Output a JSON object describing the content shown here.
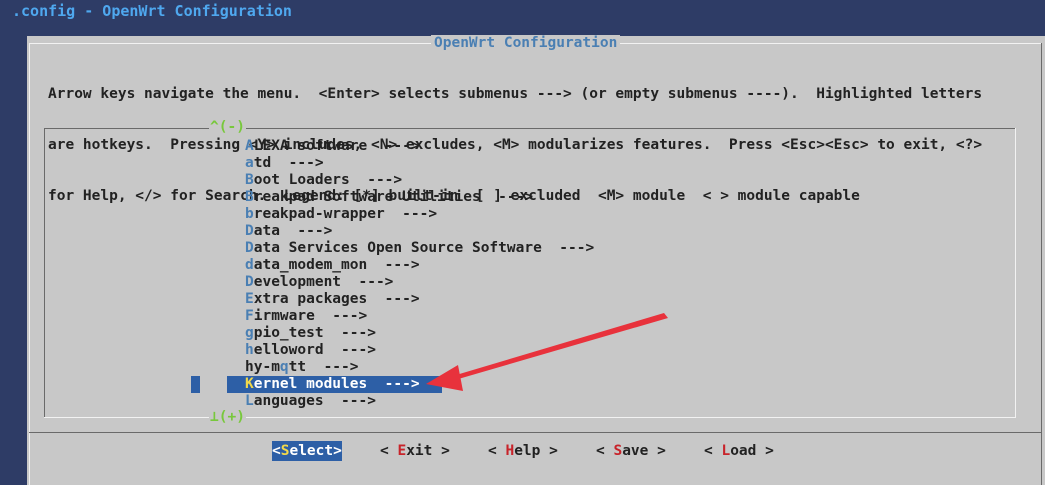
{
  "window": {
    "title": ".config - OpenWrt Configuration"
  },
  "dialog": {
    "title": "OpenWrt Configuration",
    "help_lines": [
      "Arrow keys navigate the menu.  <Enter> selects submenus ---> (or empty submenus ----).  Highlighted letters",
      "are hotkeys.  Pressing <Y> includes, <N> excludes, <M> modularizes features.  Press <Esc><Esc> to exit, <?>",
      "for Help, </> for Search.  Legend: [*] built-in  [ ] excluded  <M> module  < > module capable"
    ]
  },
  "menu": {
    "scroll_up": "^(-)",
    "scroll_down": "⊥(+)",
    "items": [
      {
        "hotkey": "A",
        "rest": "LEXA software  --->"
      },
      {
        "hotkey": "a",
        "rest": "td  --->"
      },
      {
        "hotkey": "B",
        "rest": "oot Loaders  --->"
      },
      {
        "hotkey": "B",
        "rest": "reakpad Software Utilities  --->"
      },
      {
        "hotkey": "b",
        "rest": "reakpad-wrapper  --->"
      },
      {
        "hotkey": "D",
        "rest": "ata  --->"
      },
      {
        "hotkey": "D",
        "rest": "ata Services Open Source Software  --->"
      },
      {
        "hotkey": "d",
        "rest": "ata_modem_mon  --->"
      },
      {
        "hotkey": "D",
        "rest": "evelopment  --->"
      },
      {
        "hotkey": "E",
        "rest": "xtra packages  --->"
      },
      {
        "hotkey": "F",
        "rest": "irmware  --->"
      },
      {
        "hotkey": "g",
        "rest": "pio_test  --->"
      },
      {
        "hotkey": "h",
        "rest": "elloword  --->"
      },
      {
        "pre": "hy-m",
        "hotkey": "q",
        "rest": "tt  --->"
      },
      {
        "hotkey": "K",
        "rest": "ernel modules  --->",
        "selected": true
      },
      {
        "hotkey": "L",
        "rest": "anguages  --->"
      }
    ]
  },
  "buttons": [
    {
      "pre": "<",
      "hotkey": "S",
      "rest": "elect>",
      "active": true
    },
    {
      "pre": "< ",
      "hotkey": "E",
      "rest": "xit >"
    },
    {
      "pre": "< ",
      "hotkey": "H",
      "rest": "elp >"
    },
    {
      "pre": "< ",
      "hotkey": "S",
      "rest": "ave >"
    },
    {
      "pre": "< ",
      "hotkey": "L",
      "rest": "oad >"
    }
  ],
  "colors": {
    "terminal_bg": "#2e3c66",
    "dialog_bg": "#c8c8c8",
    "selection": "#2d5fa6",
    "hotkey_menu": "#4a7fb3",
    "hotkey_button": "#c8232a",
    "annotation_arrow": "#e8323c"
  }
}
